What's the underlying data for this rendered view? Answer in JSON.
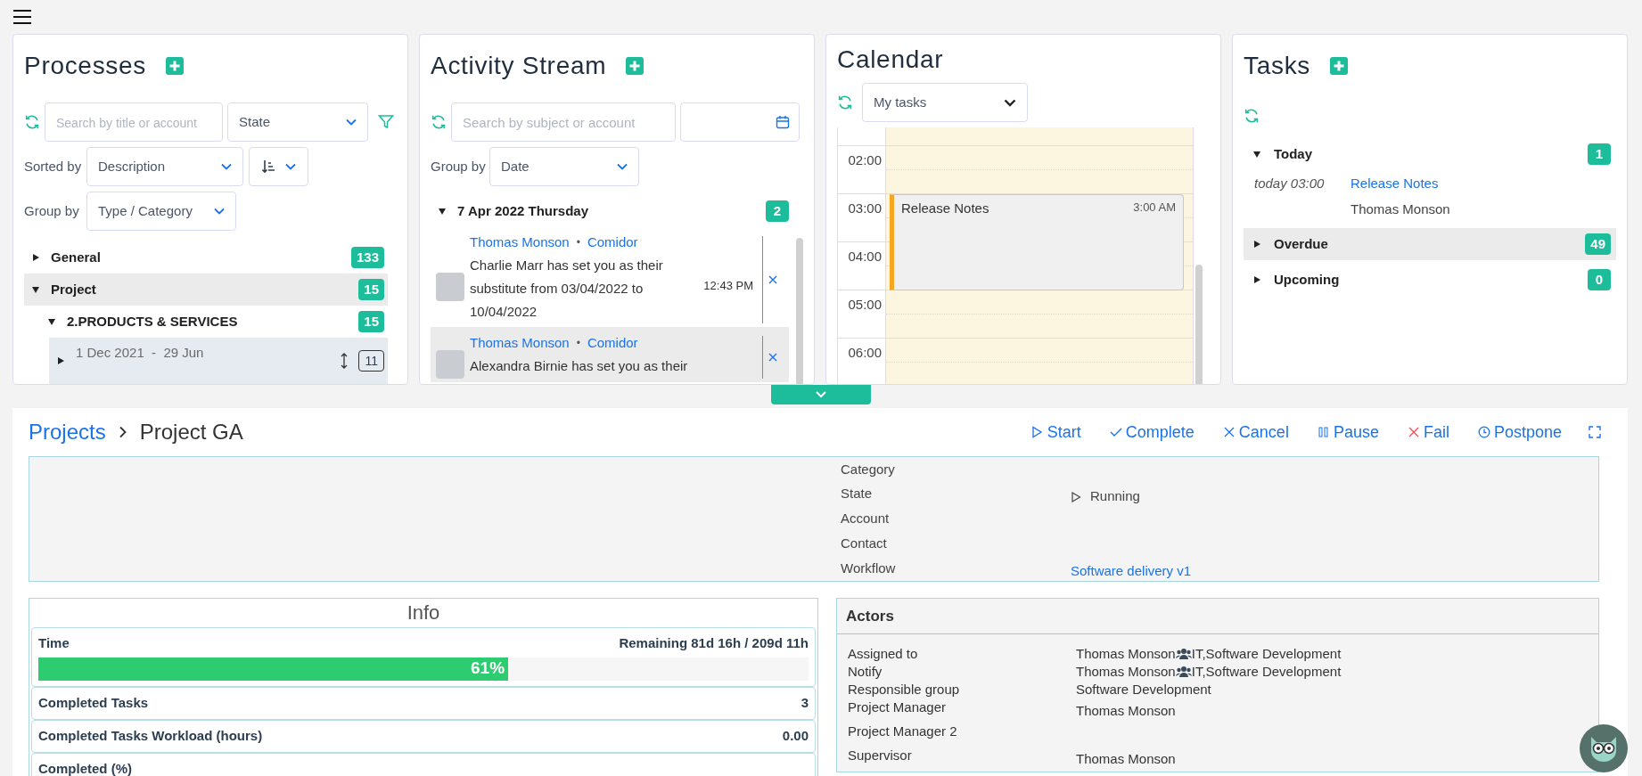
{
  "processes": {
    "title": "Processes",
    "search": {
      "placeholder": "Search by title or account"
    },
    "state_select": "State",
    "sorted_by": {
      "label": "Sorted by",
      "value": "Description"
    },
    "group_by": {
      "label": "Group by",
      "value": "Type / Category"
    },
    "tree": [
      {
        "kind": "group",
        "label": "General",
        "count": "133",
        "expanded": false,
        "selected": false
      },
      {
        "kind": "group",
        "label": "Project",
        "count": "15",
        "expanded": true,
        "selected": true,
        "children": [
          {
            "kind": "group",
            "label": "2.PRODUCTS & SERVICES",
            "count": "15",
            "expanded": true,
            "selected": false,
            "children": [
              {
                "kind": "process",
                "dates": "1 Dec 2021  -  29 Jun",
                "count": "11",
                "expanded": false,
                "selected": true
              }
            ]
          }
        ]
      }
    ]
  },
  "activity": {
    "title": "Activity Stream",
    "search": {
      "placeholder": "Search by subject or account"
    },
    "group_by": {
      "label": "Group by",
      "value": "Date"
    },
    "groups": [
      {
        "label": "7 Apr 2022 Thursday",
        "count": "2",
        "expanded": true,
        "items": [
          {
            "author": "Thomas Monson",
            "separator": "•",
            "source": "Comidor",
            "text": "Charlie Marr has set you as their substitute from 03/04/2022 to 10/04/2022",
            "time": "12:43 PM",
            "selected": false
          },
          {
            "author": "Thomas Monson",
            "separator": "•",
            "source": "Comidor",
            "text": "Alexandra Birnie has set you as their",
            "selected": true
          }
        ]
      }
    ]
  },
  "calendar": {
    "title": "Calendar",
    "filter": "My tasks",
    "hours": [
      "02:00",
      "03:00",
      "04:00",
      "05:00",
      "06:00"
    ],
    "events": [
      {
        "title": "Release Notes",
        "time": "3:00 AM",
        "color": "#f5a623"
      }
    ]
  },
  "tasks": {
    "title": "Tasks",
    "groups": [
      {
        "label": "Today",
        "count": "1",
        "expanded": true,
        "selected": false,
        "items": [
          {
            "when": "today 03:00",
            "title": "Release Notes",
            "person": "Thomas Monson"
          }
        ]
      },
      {
        "label": "Overdue",
        "count": "49",
        "expanded": false,
        "selected": true
      },
      {
        "label": "Upcoming",
        "count": "0",
        "expanded": false,
        "selected": false
      }
    ]
  },
  "detail": {
    "breadcrumb": {
      "parent": "Projects",
      "current": "Project GA"
    },
    "actions": [
      {
        "label": "Start",
        "kind": "start"
      },
      {
        "label": "Complete",
        "kind": "complete"
      },
      {
        "label": "Cancel",
        "kind": "cancel"
      },
      {
        "label": "Pause",
        "kind": "pause"
      },
      {
        "label": "Fail",
        "kind": "fail"
      },
      {
        "label": "Postpone",
        "kind": "postpone"
      }
    ],
    "fields": [
      {
        "label": "Category"
      },
      {
        "label": "State",
        "value": "Running",
        "kind": "state"
      },
      {
        "label": "Account"
      },
      {
        "label": "Contact"
      },
      {
        "label": "Workflow",
        "value": "Software delivery v1",
        "kind": "link"
      }
    ],
    "info": {
      "title": "Info",
      "rows": [
        {
          "kind": "progress",
          "label": "Time",
          "value": "Remaining 81d 16h / 209d 11h",
          "level": 0.61,
          "bar_label": "61%"
        },
        {
          "kind": "plain",
          "label": "Completed Tasks",
          "value": "3"
        },
        {
          "kind": "plain",
          "label": "Completed Tasks Workload (hours)",
          "value": "0.00"
        },
        {
          "kind": "plain",
          "label": "Completed (%)"
        }
      ]
    },
    "actors": {
      "title": "Actors",
      "rows": [
        {
          "label": "Assigned to",
          "kind": "people",
          "person": "Thomas Monson",
          "group": "IT,Software Development"
        },
        {
          "label": "Notify",
          "kind": "people",
          "person": "Thomas Monson",
          "group": "IT,Software Development"
        },
        {
          "label": "Responsible group",
          "kind": "text",
          "value": "Software Development"
        },
        {
          "label": "Project Manager",
          "kind": "text",
          "value": "Thomas Monson"
        },
        {
          "label": "Project Manager 2",
          "kind": "text"
        },
        {
          "label": "Supervisor",
          "kind": "text",
          "value": "Thomas Monson"
        }
      ]
    }
  }
}
